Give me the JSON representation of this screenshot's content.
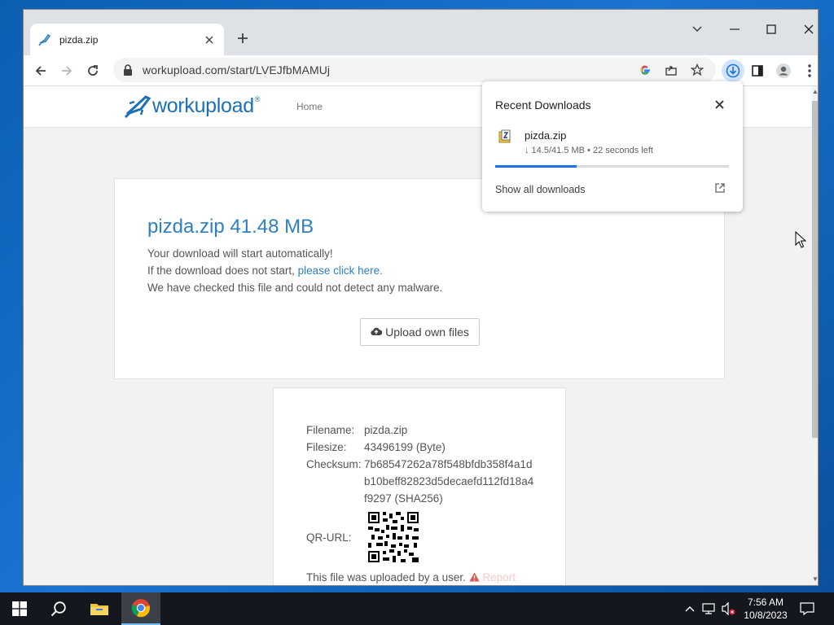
{
  "browser": {
    "tab": {
      "title": "pizda.zip"
    },
    "url": "workupload.com/start/LVEJfbMAMUj"
  },
  "site": {
    "logo_text": "workupload",
    "logo_mark": "®",
    "nav_home": "Home"
  },
  "main": {
    "title": "pizda.zip 41.48 MB",
    "line1": "Your download will start automatically!",
    "line2_prefix": "If the download does not start, ",
    "line2_link": "please click here.",
    "line3": "We have checked this file and could not detect any malware.",
    "upload_button": "Upload own files"
  },
  "details": {
    "filename_label": "Filename:",
    "filename_value": "pizda.zip",
    "filesize_label": "Filesize:",
    "filesize_value": "43496199 (Byte)",
    "checksum_label": "Checksum:",
    "checksum_value": "7b68547262a78f548bfdb358f4a1db10beff82823d5decaefd112fd18a4f9297 (SHA256)",
    "qr_label": "QR-URL:",
    "uploaded_note": "This file was uploaded by a user.",
    "report_link": "Report file"
  },
  "downloads_popup": {
    "title": "Recent Downloads",
    "file_name": "pizda.zip",
    "status": "↓ 14.5/41.5 MB • 22 seconds left",
    "progress": 0.35,
    "show_all": "Show all downloads"
  },
  "taskbar": {
    "time": "7:56 AM",
    "date": "10/8/2023"
  },
  "colors": {
    "accent": "#1a73e8",
    "brand": "#2f80c0",
    "desktop": "#0b5fb3",
    "taskbar": "#14181e"
  }
}
